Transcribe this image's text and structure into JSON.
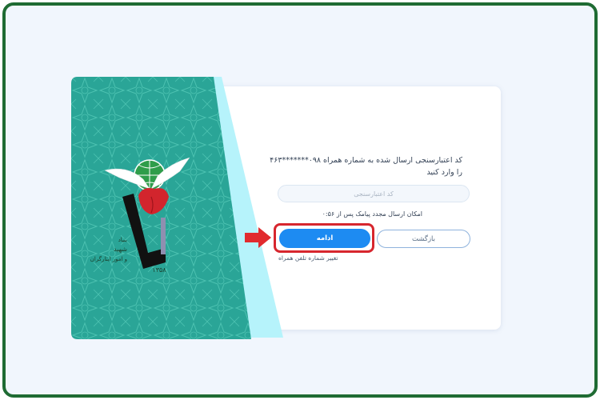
{
  "verification": {
    "message": "کد اعتبارسنجی ارسال شده به شماره همراه ۰۹۸*******۴۶۳ را وارد کنید",
    "input_placeholder": "کد اعتبارسنجی",
    "resend_text": "امکان ارسال مجدد پیامک پس از ۰:۵۶",
    "continue_label": "ادامه",
    "back_label": "بازگشت",
    "change_phone_label": "تغییر شماره تلفن همراه"
  },
  "logo": {
    "text_line1": "بنیاد",
    "text_line2": "شهید",
    "text_line3": "و امور ایثارگران",
    "year": "۱۳۵۸"
  },
  "colors": {
    "frame_border": "#1f6b33",
    "primary_button": "#1d8bf2",
    "highlight": "#d7262e",
    "panel_teal": "#2aa597",
    "panel_stripe": "#b6f3fb"
  }
}
